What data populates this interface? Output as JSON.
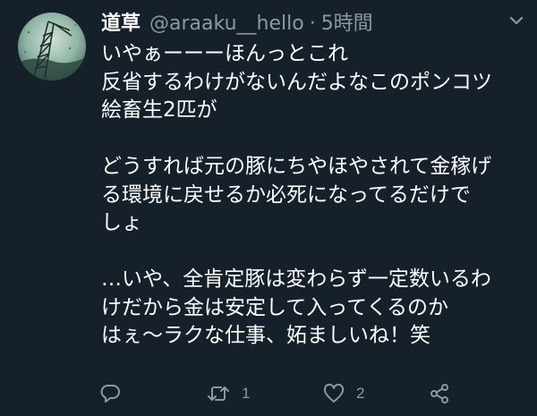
{
  "tweet": {
    "display_name": "道草",
    "handle": "@araaku__hello",
    "separator": "·",
    "time": "5時間",
    "lines": [
      "いやぁーーーほんっとこれ",
      "反省するわけがないんだよなこのポンコツ",
      "絵畜生2匹が",
      "",
      "どうすれば元の豚にちやほやされて金稼げ",
      "る環境に戻せるか必死になってるだけで",
      "しょ",
      "",
      "…いや、全肯定豚は変わらず一定数いるわ",
      "けだから金は安定して入ってくるのか",
      "はぇ〜ラクな仕事、妬ましいね！笑"
    ],
    "actions": {
      "reply_icon": "reply-icon",
      "retweet_icon": "retweet-icon",
      "retweet_count": "1",
      "like_icon": "heart-icon",
      "like_count": "2",
      "share_icon": "share-icon"
    }
  },
  "colors": {
    "background": "#15202b",
    "text_primary": "#ffffff",
    "text_secondary": "#8b98a5"
  }
}
